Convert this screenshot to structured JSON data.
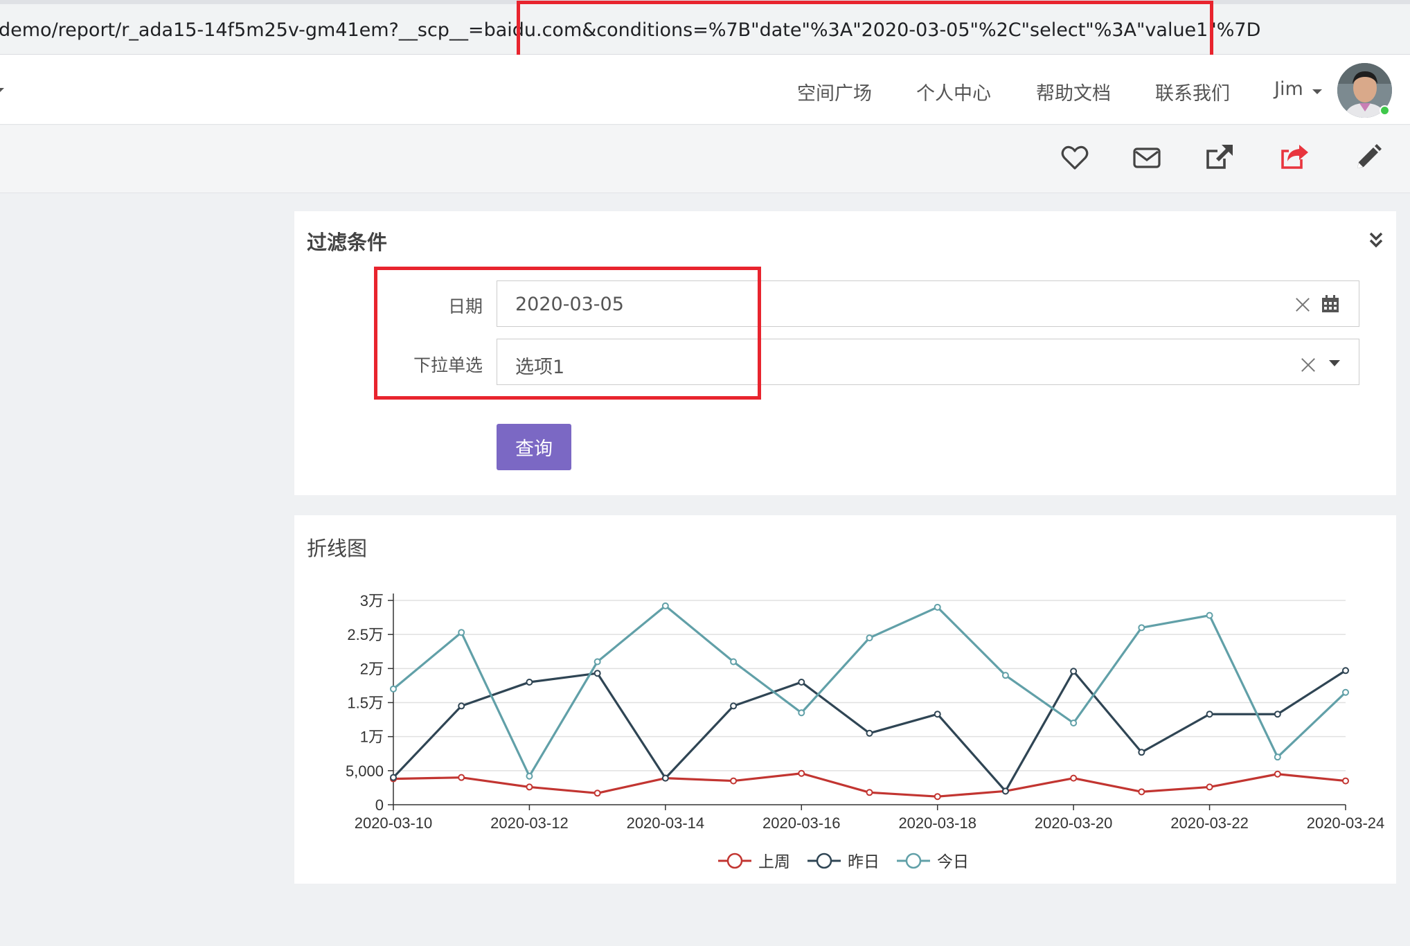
{
  "browser": {
    "url": "demo/report/r_ada15-14f5m25v-gm41em?__scp__=baidu.com&conditions=%7B\"date\"%3A\"2020-03-05\"%2C\"select\"%3A\"value1\"%7D"
  },
  "navbar": {
    "items": [
      "空间广场",
      "个人中心",
      "帮助文档",
      "联系我们"
    ],
    "user": "Jim"
  },
  "toolbar": {
    "icons": [
      "heart-icon",
      "mail-icon",
      "external-link-icon",
      "share-icon",
      "pencil-icon"
    ],
    "share_color": "#e8353e"
  },
  "filter": {
    "title": "过滤条件",
    "date_label": "日期",
    "date_value": "2020-03-05",
    "select_label": "下拉单选",
    "select_value": "选项1",
    "query_button": "查询"
  },
  "chart_panel": {
    "title": "折线图"
  },
  "chart_data": {
    "type": "line",
    "x": [
      "2020-03-10",
      "2020-03-11",
      "2020-03-12",
      "2020-03-13",
      "2020-03-14",
      "2020-03-15",
      "2020-03-16",
      "2020-03-17",
      "2020-03-18",
      "2020-03-19",
      "2020-03-20",
      "2020-03-21",
      "2020-03-22",
      "2020-03-23",
      "2020-03-24"
    ],
    "x_tick_labels": [
      "2020-03-10",
      "2020-03-12",
      "2020-03-14",
      "2020-03-16",
      "2020-03-18",
      "2020-03-20",
      "2020-03-22",
      "2020-03-24"
    ],
    "y_tick_labels": [
      "0",
      "5,000",
      "1万",
      "1.5万",
      "2万",
      "2.5万",
      "3万"
    ],
    "ylim": [
      0,
      30000
    ],
    "grid": true,
    "legend_position": "bottom-center",
    "series": [
      {
        "name": "上周",
        "color": "#c23531",
        "values": [
          3800,
          4000,
          2600,
          1700,
          3900,
          3500,
          4600,
          1800,
          1200,
          2000,
          3900,
          1900,
          2600,
          4500,
          3500
        ]
      },
      {
        "name": "昨日",
        "color": "#2f4554",
        "values": [
          4000,
          14500,
          18000,
          19300,
          3900,
          14500,
          18000,
          10500,
          13300,
          2000,
          19600,
          7700,
          13300,
          13300,
          19700
        ]
      },
      {
        "name": "今日",
        "color": "#61a0a8",
        "values": [
          17000,
          25300,
          4200,
          21000,
          29200,
          21000,
          13500,
          24500,
          29000,
          19000,
          12000,
          26000,
          27800,
          7000,
          16500
        ]
      }
    ]
  }
}
